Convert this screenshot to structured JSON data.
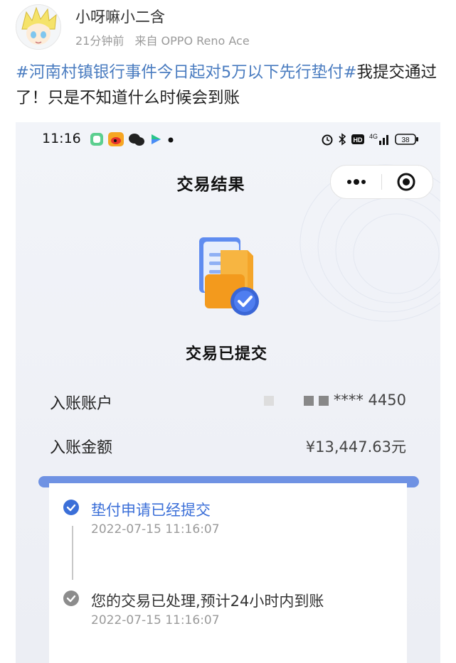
{
  "post": {
    "username": "小呀嘛小二含",
    "time_ago": "21分钟前",
    "source": "来自 OPPO Reno Ace",
    "hashtag": "#河南村镇银行事件今日起对5万以下先行垫付#",
    "text_after_hashtag": "我提交通过了！只是不知道什么时候会到账"
  },
  "status_bar": {
    "time": "11:16",
    "network": "4G",
    "battery": "38"
  },
  "page": {
    "title": "交易结果",
    "result": "交易已提交",
    "account_label": "入账账户",
    "account_value": "**** 4450",
    "amount_label": "入账金额",
    "amount_value": "¥13,447.63元"
  },
  "steps": [
    {
      "title": "垫付申请已经提交",
      "time": "2022-07-15 11:16:07",
      "status": "active"
    },
    {
      "title": "您的交易已处理,预计24小时内到账",
      "time": "2022-07-15 11:16:07",
      "status": "done"
    }
  ],
  "colors": {
    "hashtag": "#4a7cc0",
    "active_step": "#3b6fd8",
    "done_step": "#8c8c8c",
    "band": "#6f92e3"
  }
}
